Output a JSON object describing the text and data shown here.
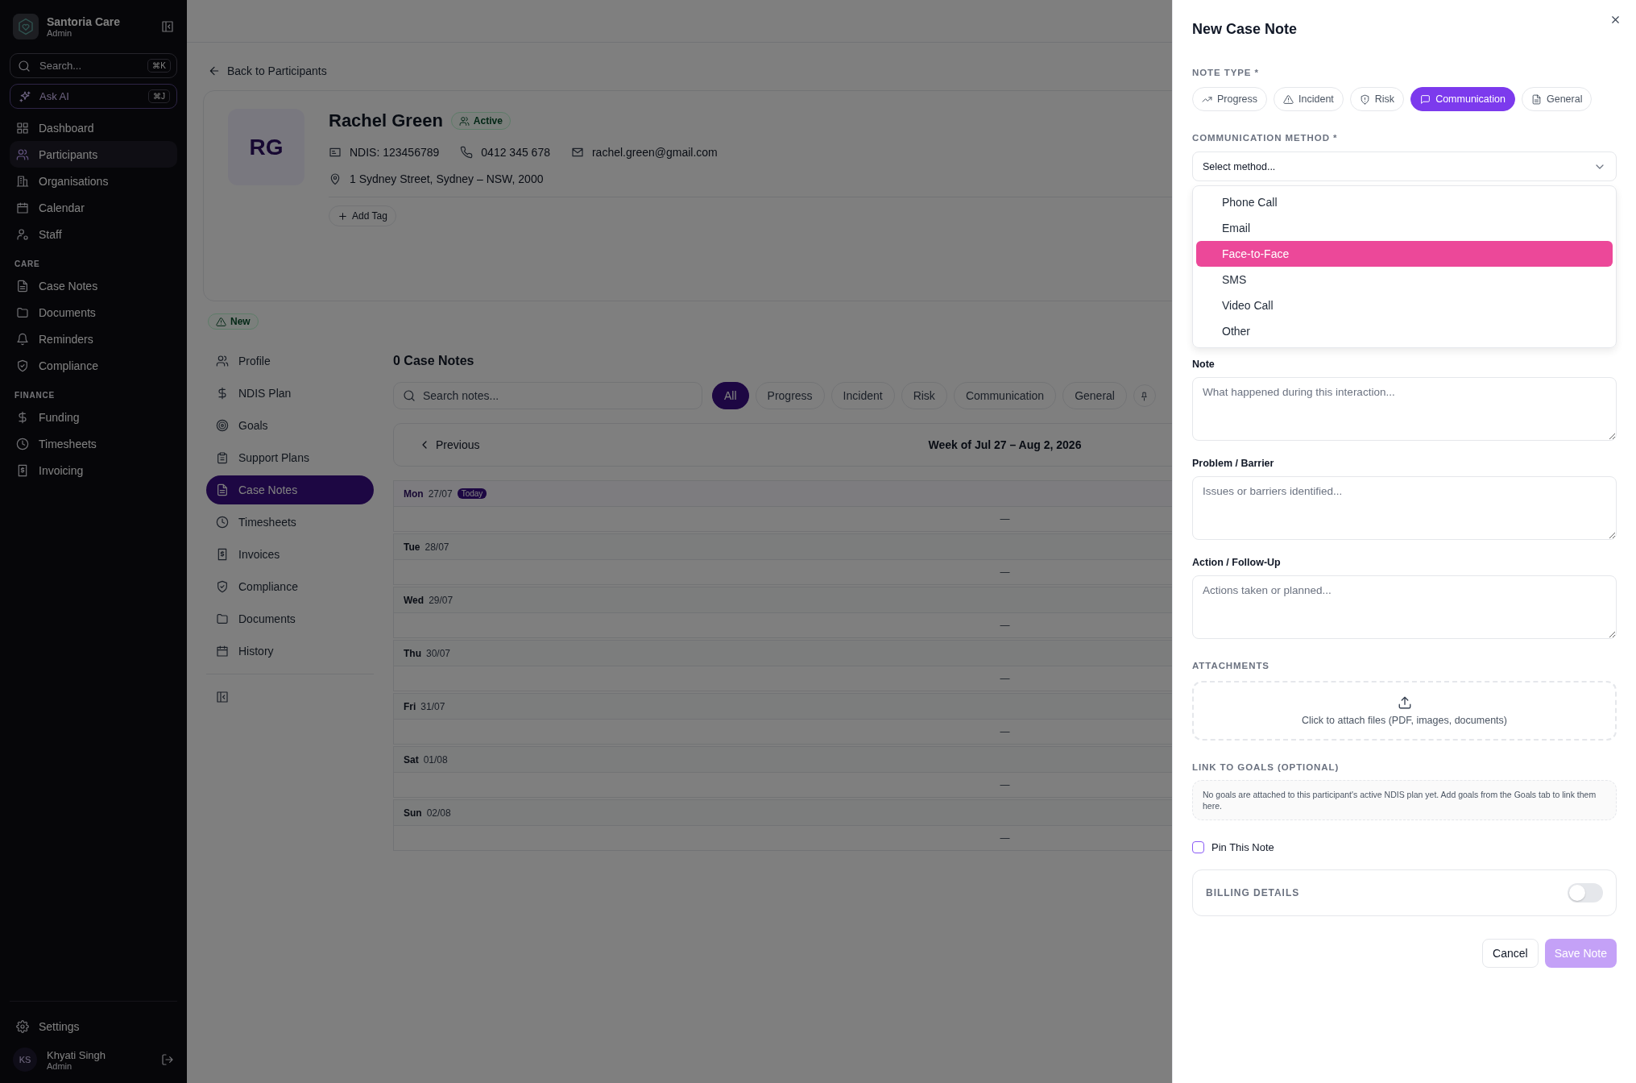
{
  "sidebar": {
    "brand": "Santoria Care",
    "role": "Admin",
    "search": {
      "placeholder": "Search...",
      "shortcut": "⌘K"
    },
    "ask_ai": {
      "label": "Ask AI",
      "shortcut": "⌘J"
    },
    "sections": [
      {
        "items": [
          {
            "label": "Dashboard",
            "selected": false
          },
          {
            "label": "Participants",
            "selected": true
          },
          {
            "label": "Organisations",
            "selected": false
          },
          {
            "label": "Calendar",
            "selected": false
          },
          {
            "label": "Staff",
            "selected": false
          }
        ]
      },
      {
        "heading": "CARE",
        "items": [
          {
            "label": "Case Notes",
            "selected": false
          },
          {
            "label": "Documents",
            "selected": false
          },
          {
            "label": "Reminders",
            "selected": false
          },
          {
            "label": "Compliance",
            "selected": false
          }
        ]
      },
      {
        "heading": "FINANCE",
        "items": [
          {
            "label": "Funding",
            "selected": false
          },
          {
            "label": "Timesheets",
            "selected": false
          },
          {
            "label": "Invoicing",
            "selected": false
          }
        ]
      }
    ],
    "settings": "Settings",
    "user": {
      "initials": "KS",
      "name": "Khyati Singh",
      "role": "Admin"
    }
  },
  "main": {
    "back_link": "Back to Participants",
    "participant": {
      "initials": "RG",
      "name": "Rachel Green",
      "status": "Active",
      "ndis": "NDIS: 123456789",
      "phone": "0412 345 678",
      "email": "rachel.green@gmail.com",
      "address": "1 Sydney Street, Sydney – NSW, 2000",
      "add_tag": "Add Tag"
    },
    "badge": "New",
    "tabs": [
      {
        "label": "Profile",
        "selected": false
      },
      {
        "label": "NDIS Plan",
        "selected": false
      },
      {
        "label": "Goals",
        "selected": false
      },
      {
        "label": "Support Plans",
        "selected": false
      },
      {
        "label": "Case Notes",
        "selected": true
      },
      {
        "label": "Timesheets",
        "selected": false
      },
      {
        "label": "Invoices",
        "selected": false
      },
      {
        "label": "Compliance",
        "selected": false
      },
      {
        "label": "Documents",
        "selected": false
      },
      {
        "label": "History",
        "selected": false
      }
    ],
    "case_notes": {
      "title": "0 Case Notes",
      "search": {
        "placeholder": "Search notes..."
      },
      "filters": [
        {
          "label": "All",
          "selected": true
        },
        {
          "label": "Progress",
          "selected": false
        },
        {
          "label": "Incident",
          "selected": false
        },
        {
          "label": "Risk",
          "selected": false
        },
        {
          "label": "Communication",
          "selected": false
        },
        {
          "label": "General",
          "selected": false
        }
      ],
      "previous": "Previous",
      "week": "Week of Jul 27 – Aug 2, 2026",
      "days": [
        {
          "day": "Mon",
          "date": "27/07",
          "today": true,
          "badge": "Today",
          "entry": "—"
        },
        {
          "day": "Tue",
          "date": "28/07",
          "today": false,
          "entry": "—"
        },
        {
          "day": "Wed",
          "date": "29/07",
          "today": false,
          "entry": "—"
        },
        {
          "day": "Thu",
          "date": "30/07",
          "today": false,
          "entry": "—"
        },
        {
          "day": "Fri",
          "date": "31/07",
          "today": false,
          "entry": "—"
        },
        {
          "day": "Sat",
          "date": "01/08",
          "today": false,
          "entry": "—"
        },
        {
          "day": "Sun",
          "date": "02/08",
          "today": false,
          "entry": "—"
        }
      ]
    }
  },
  "drawer": {
    "title": "New Case Note",
    "note_type": {
      "label": "NOTE TYPE *",
      "options": [
        {
          "label": "Progress",
          "selected": false
        },
        {
          "label": "Incident",
          "selected": false
        },
        {
          "label": "Risk",
          "selected": false
        },
        {
          "label": "Communication",
          "selected": true
        },
        {
          "label": "General",
          "selected": false
        }
      ]
    },
    "method": {
      "label": "COMMUNICATION METHOD *",
      "placeholder": "Select method...",
      "options": [
        {
          "label": "Phone Call",
          "highlighted": false
        },
        {
          "label": "Email",
          "highlighted": false
        },
        {
          "label": "Face-to-Face",
          "highlighted": true
        },
        {
          "label": "SMS",
          "highlighted": false
        },
        {
          "label": "Video Call",
          "highlighted": false
        },
        {
          "label": "Other",
          "highlighted": false
        }
      ]
    },
    "fields": [
      {
        "label": "Note",
        "placeholder": "What happened during this interaction..."
      },
      {
        "label": "Problem / Barrier",
        "placeholder": "Issues or barriers identified..."
      },
      {
        "label": "Action / Follow-Up",
        "placeholder": "Actions taken or planned..."
      }
    ],
    "attachments": {
      "label": "ATTACHMENTS",
      "hint": "Click to attach files (PDF, images, documents)"
    },
    "goals": {
      "label": "LINK TO GOALS (OPTIONAL)",
      "message": "No goals are attached to this participant's active NDIS plan yet. Add goals from the Goals tab to link them here."
    },
    "pin": {
      "label": "Pin This Note",
      "checked": false
    },
    "billing": {
      "label": "BILLING DETAILS",
      "on": false
    },
    "cancel": "Cancel",
    "save": {
      "label": "Save Note",
      "disabled": true
    }
  }
}
